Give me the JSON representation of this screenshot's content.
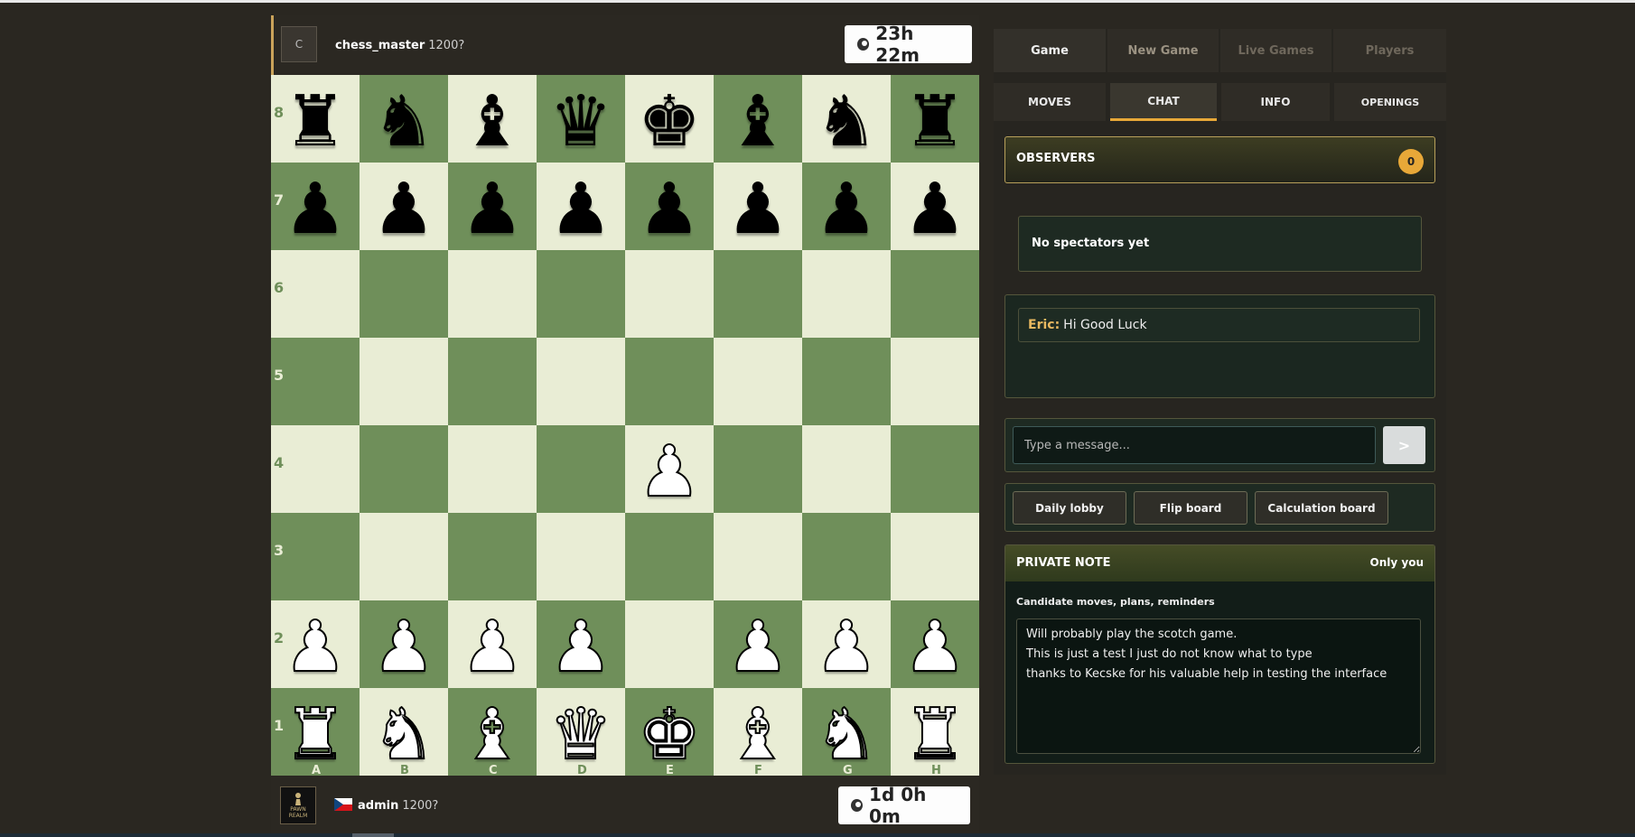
{
  "player_top": {
    "avatar_letter": "C",
    "name": "chess_master",
    "rating": "1200?",
    "clock": "23h 22m"
  },
  "player_bottom": {
    "avatar_text": "PAWN REALM",
    "flag": "czech-flag-icon",
    "name": "admin",
    "rating": "1200?",
    "clock": "1d 0h 0m"
  },
  "board": {
    "ranks": [
      "8",
      "7",
      "6",
      "5",
      "4",
      "3",
      "2",
      "1"
    ],
    "files": [
      "A",
      "B",
      "C",
      "D",
      "E",
      "F",
      "G",
      "H"
    ],
    "position": [
      [
        "br",
        "bn",
        "bb",
        "bq",
        "bk",
        "bb",
        "bn",
        "br"
      ],
      [
        "bp",
        "bp",
        "bp",
        "bp",
        "bp",
        "bp",
        "bp",
        "bp"
      ],
      [
        "",
        "",
        "",
        "",
        "",
        "",
        "",
        ""
      ],
      [
        "",
        "",
        "",
        "",
        "",
        "",
        "",
        ""
      ],
      [
        "",
        "",
        "",
        "",
        "wp",
        "",
        "",
        ""
      ],
      [
        "",
        "",
        "",
        "",
        "",
        "",
        "",
        ""
      ],
      [
        "wp",
        "wp",
        "wp",
        "wp",
        "",
        "wp",
        "wp",
        "wp"
      ],
      [
        "wr",
        "wn",
        "wb",
        "wq",
        "wk",
        "wb",
        "wn",
        "wr"
      ]
    ]
  },
  "tabs": {
    "main": [
      "Game",
      "New Game",
      "Live Games",
      "Players"
    ],
    "sub": [
      "MOVES",
      "CHAT",
      "INFO",
      "OPENINGS"
    ],
    "active_main": "Game",
    "active_sub": "CHAT"
  },
  "observers": {
    "title": "OBSERVERS",
    "count": "0",
    "empty_text": "No spectators yet"
  },
  "chat": {
    "messages": [
      {
        "author": "Eric:",
        "text": "Hi Good Luck"
      }
    ],
    "placeholder": "Type a message...",
    "send_label": ">"
  },
  "actions": [
    "Daily lobby",
    "Flip board",
    "Calculation board"
  ],
  "private_note": {
    "title": "PRIVATE NOTE",
    "visibility": "Only you",
    "label": "Candidate moves, plans, reminders",
    "text": "Will probably play the scotch game.\nThis is just a test I just do not know what to type\nthanks to Kecske for his valuable help in testing the interface"
  },
  "colors": {
    "accent": "#e8a838",
    "light_square": "#e9edd5",
    "dark_square": "#6f8f5a",
    "background": "#2a2721"
  }
}
